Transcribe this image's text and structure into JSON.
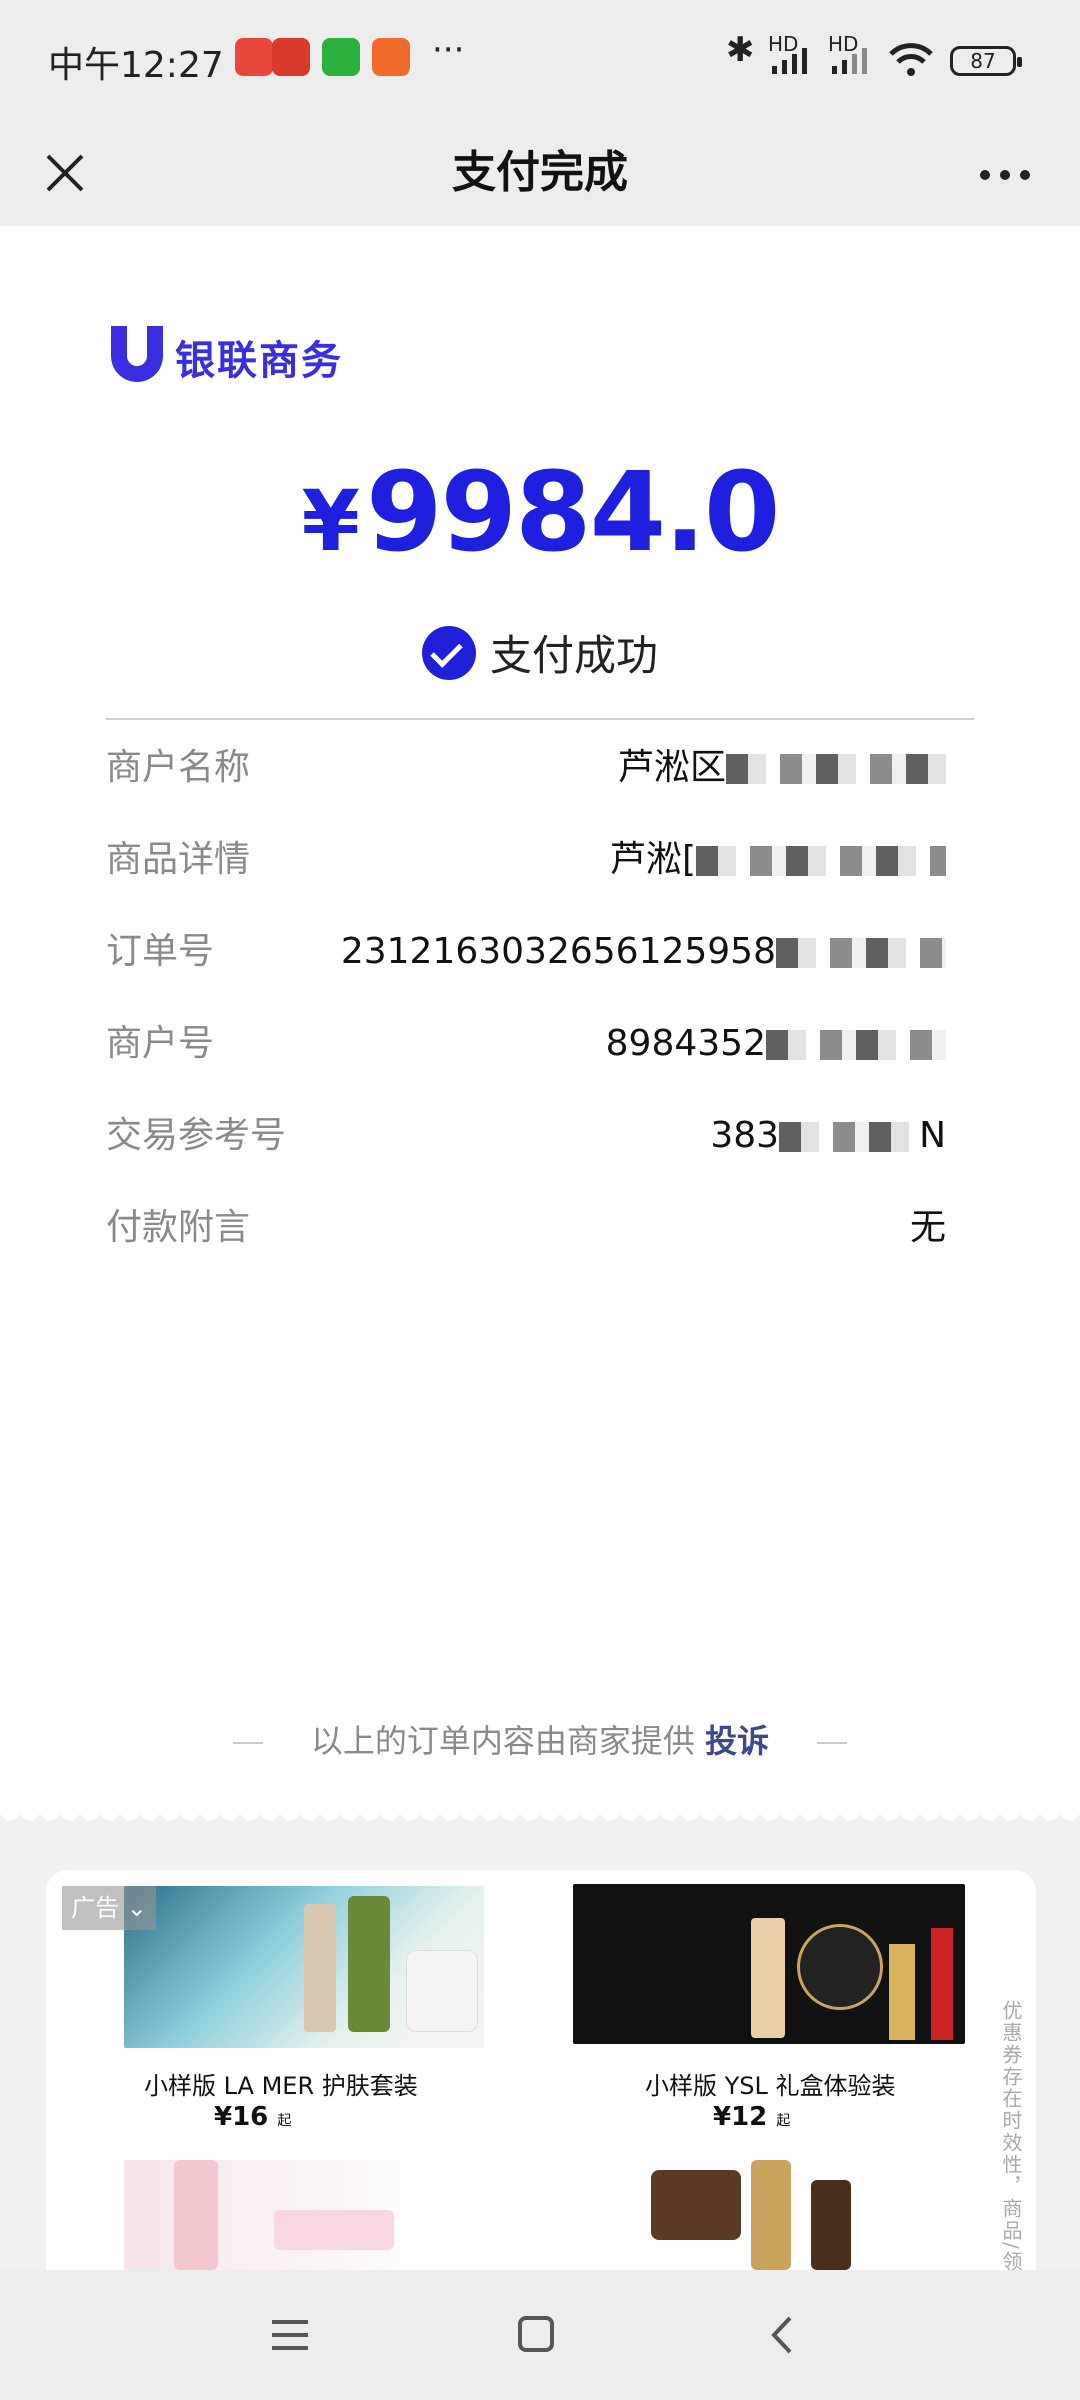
{
  "status_bar": {
    "time": "中午12:27",
    "more": "···",
    "battery": "87",
    "hd1": "HD",
    "hd2": "HD"
  },
  "nav": {
    "title": "支付完成",
    "icons": [
      "close-icon",
      "more-icon"
    ]
  },
  "merchant_logo": {
    "text": "银联商务",
    "brand_color": "#3a2fe0"
  },
  "payment": {
    "currency": "¥",
    "amount": "9984.0",
    "status": "支付成功",
    "accent_color": "#1f1fe0"
  },
  "details": [
    {
      "label": "商户名称",
      "value": "芦淞区"
    },
    {
      "label": "商品详情",
      "value": "芦淞["
    },
    {
      "label": "订单号",
      "value": "2312163032656125958"
    },
    {
      "label": "商户号",
      "value": "8984352"
    },
    {
      "label": "交易参考号",
      "value": "383",
      "suffix": "N"
    },
    {
      "label": "付款附言",
      "value": "无"
    }
  ],
  "footer": {
    "note": "以上的订单内容由商家提供",
    "complain": "投诉"
  },
  "ad": {
    "badge": "广告",
    "side_note": "优惠券存在时效性，商品/领券",
    "products": [
      {
        "name": "小样版   LA MER   护肤套装",
        "price": "¥16",
        "unit": "起"
      },
      {
        "name": "小样版   YSL 礼盒体验装",
        "price": "¥12",
        "unit": "起"
      }
    ]
  }
}
